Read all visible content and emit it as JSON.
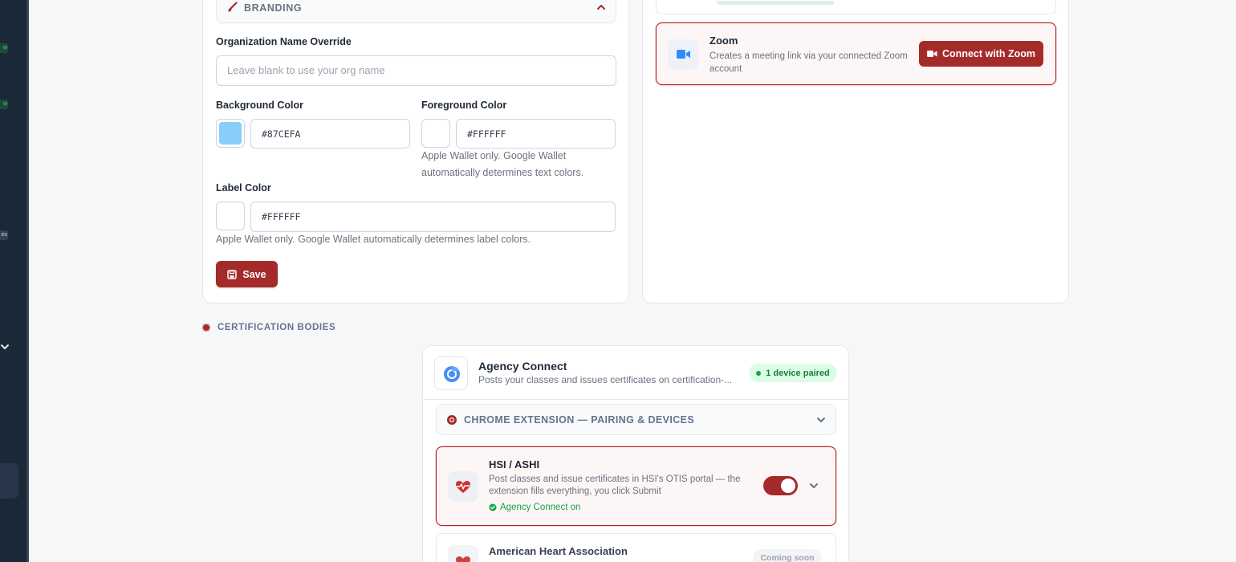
{
  "sidebar": {
    "badges": [
      "w",
      "w",
      "es"
    ]
  },
  "branding": {
    "section_title": "BRANDING",
    "org_name_label": "Organization Name Override",
    "org_name_placeholder": "Leave blank to use your org name",
    "org_name_value": "",
    "bg_color_label": "Background Color",
    "bg_color_value": "#87CEFA",
    "fg_color_label": "Foreground Color",
    "fg_color_value": "#FFFFFF",
    "fg_hint": "Apple Wallet only. Google Wallet automatically determines text colors.",
    "label_color_label": "Label Color",
    "label_color_value": "#FFFFFF",
    "label_hint": "Apple Wallet only. Google Wallet automatically determines label colors.",
    "save_label": "Save"
  },
  "integrations": {
    "zoom": {
      "title": "Zoom",
      "description": "Creates a meeting link via your connected Zoom account",
      "button_label": "Connect with Zoom"
    }
  },
  "certification": {
    "heading": "CERTIFICATION BODIES",
    "agency_connect": {
      "title": "Agency Connect",
      "description": "Posts your classes and issues certificates on certification-...",
      "badge": "1 device paired"
    },
    "extension_section": "CHROME EXTENSION — PAIRING & DEVICES",
    "hsi": {
      "title": "HSI / ASHI",
      "description": "Post classes and issue certificates in HSI's OTIS portal — the extension fills everything, you click Submit",
      "status": "Agency Connect on",
      "toggle_on": true
    },
    "aha": {
      "title": "American Heart Association",
      "badge": "Coming soon"
    }
  },
  "colors": {
    "accent": "#A52A2A",
    "sidebar": "#1B2838",
    "success": "#16A34A"
  }
}
